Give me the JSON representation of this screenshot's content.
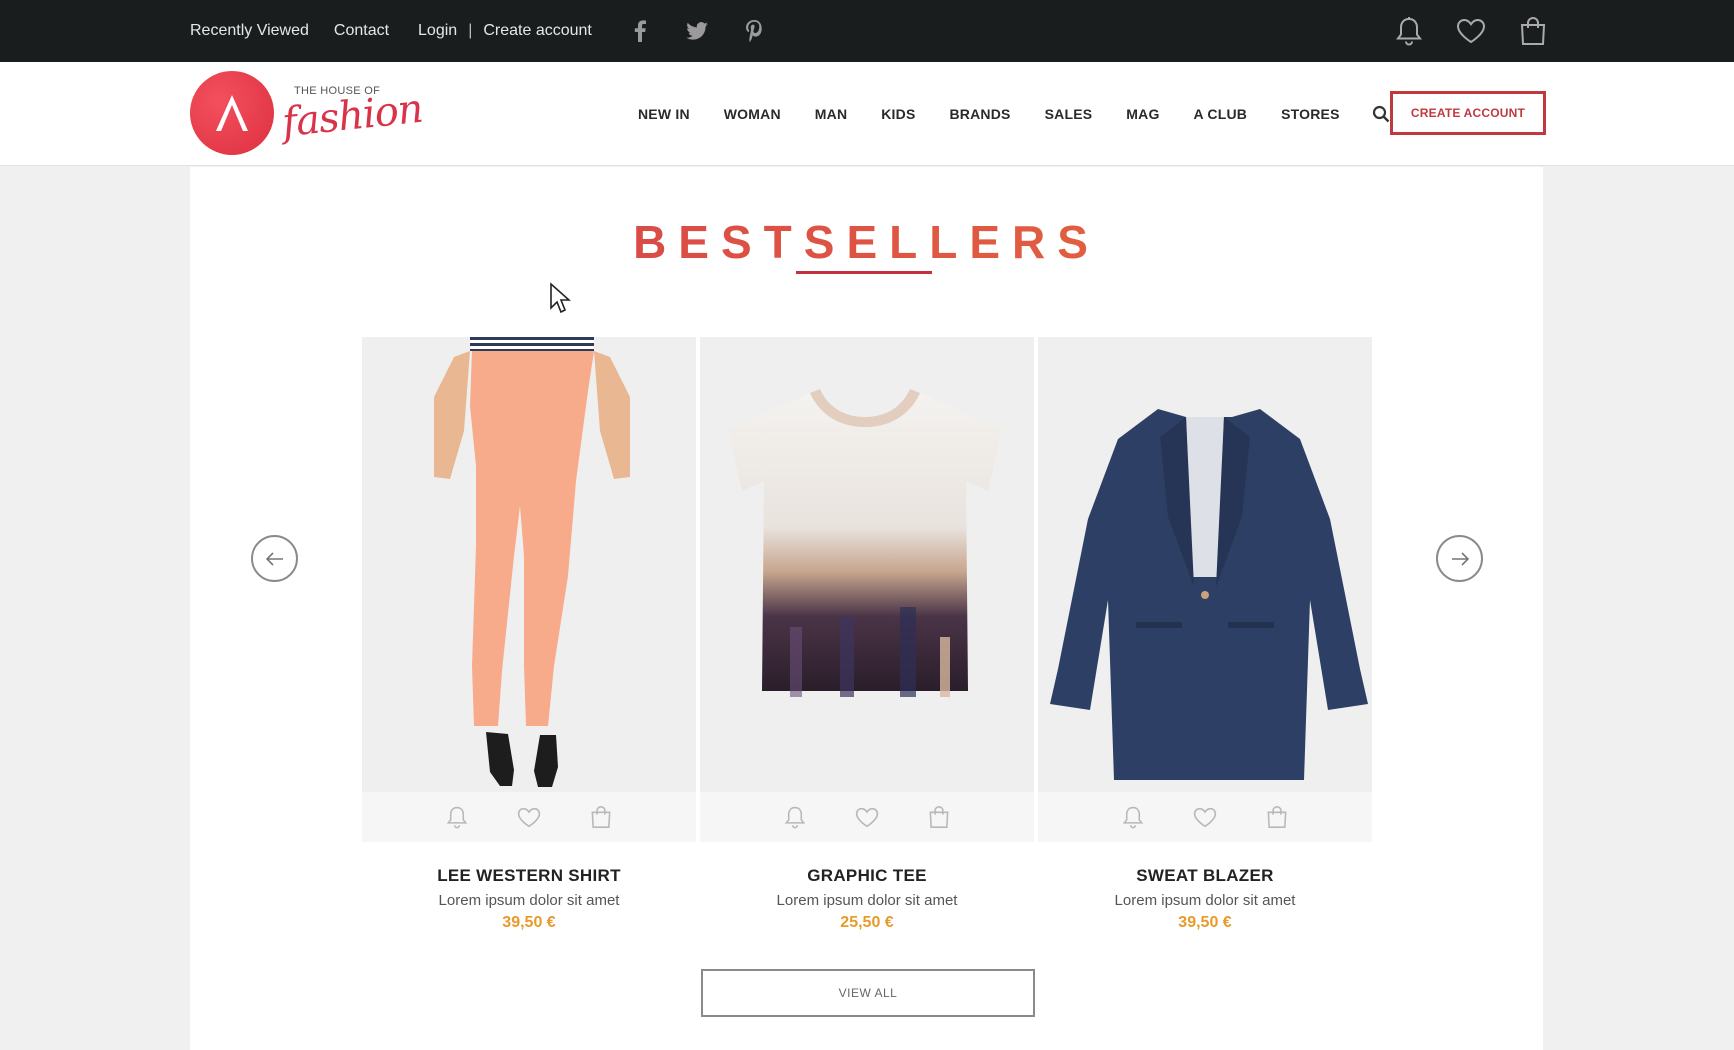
{
  "topbar": {
    "recently_viewed": "Recently Viewed",
    "contact": "Contact",
    "login": "Login",
    "separator": "|",
    "create_account": "Create account",
    "social": [
      "facebook-icon",
      "twitter-icon",
      "pinterest-icon"
    ],
    "right_icons": [
      "bell-icon",
      "heart-icon",
      "shopping-bag-icon"
    ]
  },
  "header": {
    "logo_small": "THE HOUSE OF",
    "logo_script": "fashion",
    "nav": [
      "NEW IN",
      "WOMAN",
      "MAN",
      "KIDS",
      "BRANDS",
      "SALES",
      "MAG",
      "A CLUB",
      "STORES"
    ],
    "create_account_button": "CREATE ACCOUNT"
  },
  "bestsellers": {
    "title": "BESTSELLERS",
    "products": [
      {
        "name": "LEE WESTERN SHIRT",
        "desc": "Lorem ipsum dolor sit amet",
        "price": "39,50 €"
      },
      {
        "name": "GRAPHIC TEE",
        "desc": "Lorem ipsum dolor sit amet",
        "price": "25,50 €"
      },
      {
        "name": "SWEAT BLAZER",
        "desc": "Lorem ipsum dolor sit amet",
        "price": "39,50 €"
      }
    ],
    "view_all": "VIEW ALL"
  },
  "colors": {
    "topbar_bg": "#1a1d1e",
    "accent_red": "#c0393f",
    "price_orange": "#e89a2a"
  }
}
